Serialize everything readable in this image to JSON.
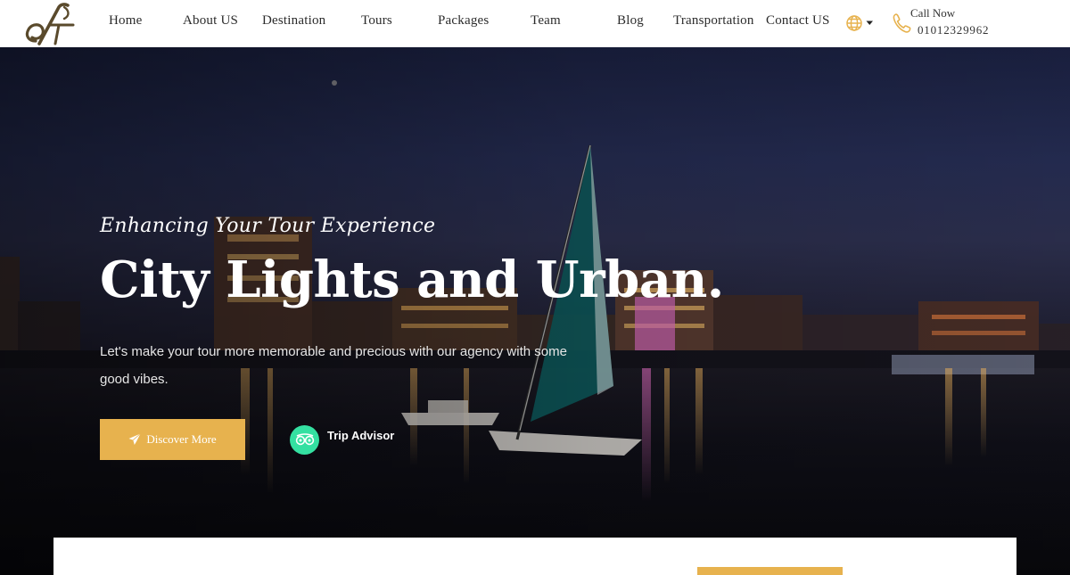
{
  "brand": {
    "accent_color": "#e7b24e",
    "logo_icon": "monogram-logo"
  },
  "nav": {
    "items": [
      {
        "label": "Home"
      },
      {
        "label": "About US"
      },
      {
        "label": "Destination"
      },
      {
        "label": "Tours"
      },
      {
        "label": "Packages"
      },
      {
        "label": "Team"
      },
      {
        "label": "Blog"
      },
      {
        "label": "Transportation"
      },
      {
        "label": "Contact US"
      }
    ],
    "language_icon": "globe-icon",
    "dropdown_icon": "caret-down-icon"
  },
  "contact": {
    "label": "Call Now",
    "phone": "01012329962",
    "icon": "phone-icon"
  },
  "hero": {
    "tagline": "Enhancing Your Tour Experience",
    "headline": "City Lights and Urban.",
    "subtext": "Let's make your tour more memorable and precious with our agency with some good vibes.",
    "discover_label": "Discover More",
    "discover_icon": "paper-plane-icon",
    "trip_label": "Trip Advisor",
    "trip_icon": "tripadvisor-owl-icon",
    "trip_icon_color": "#34e0a1"
  }
}
